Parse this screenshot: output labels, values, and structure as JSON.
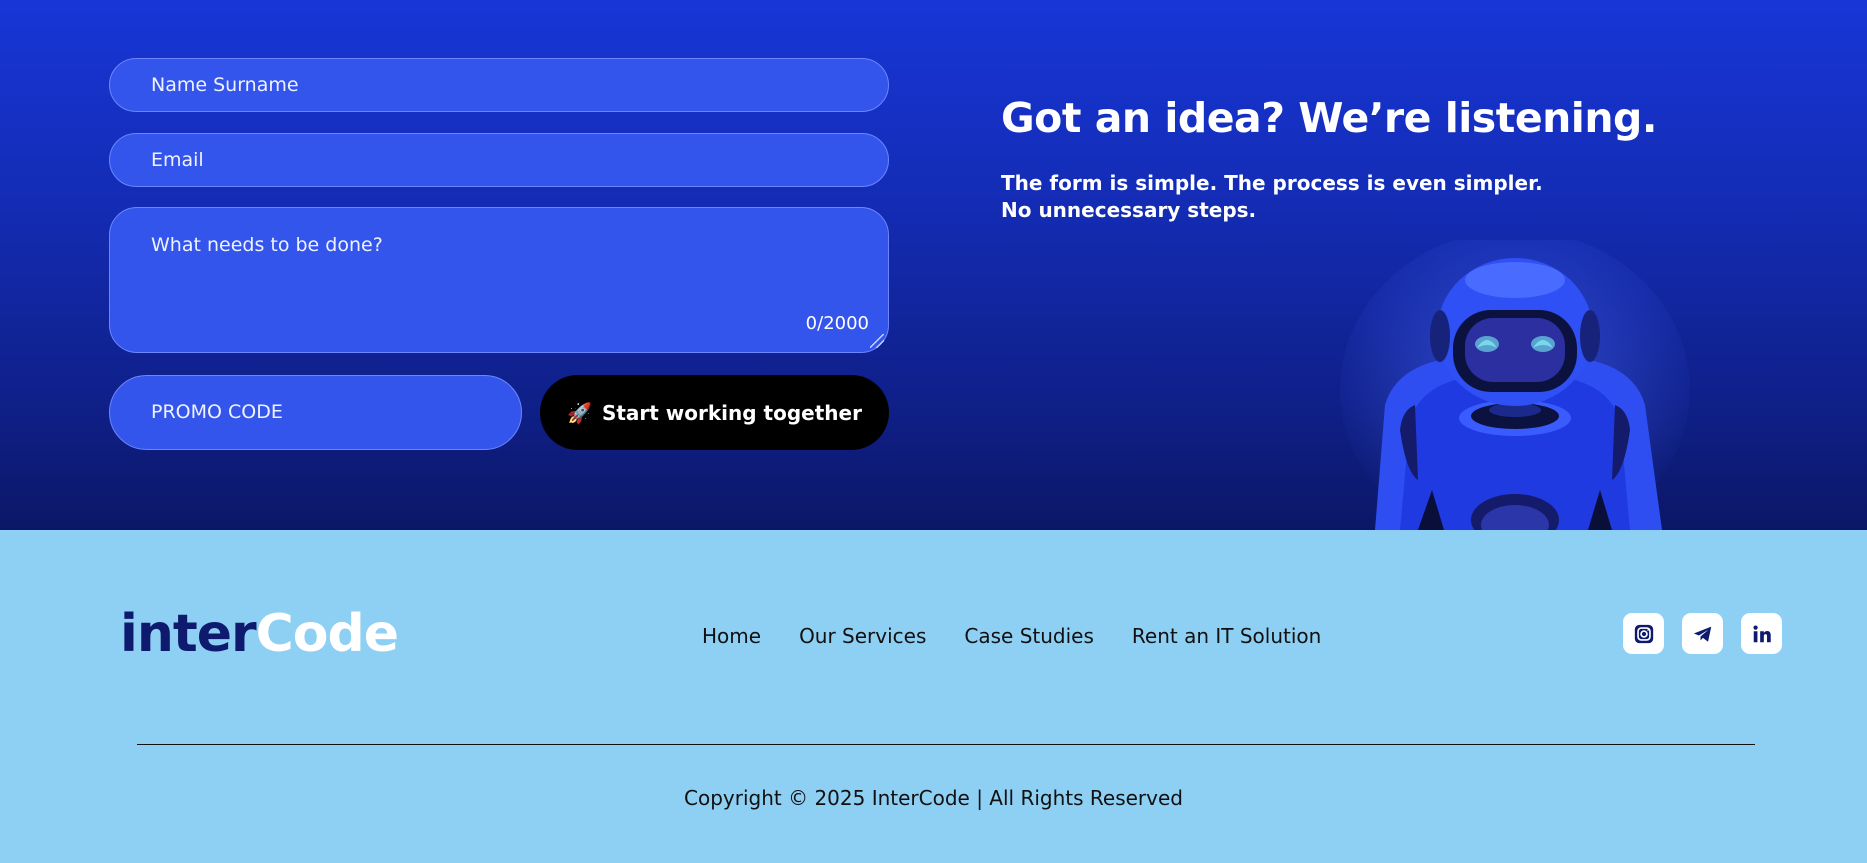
{
  "form": {
    "name_placeholder": "Name Surname",
    "email_placeholder": "Email",
    "message_placeholder": "What needs to be done?",
    "char_counter": "0/2000",
    "promo_placeholder": "PROMO CODE",
    "submit_label": "Start working together",
    "submit_icon": "🚀"
  },
  "hero": {
    "headline": "Got an idea? We’re listening.",
    "subline_1": "The form is simple. The process is even simpler.",
    "subline_2": "No unnecessary steps."
  },
  "footer": {
    "logo_part1": "inter",
    "logo_part2": "Code",
    "nav": [
      "Home",
      "Our Services",
      "Case Studies",
      "Rent an IT Solution"
    ],
    "socials": [
      "instagram-icon",
      "telegram-icon",
      "linkedin-icon"
    ],
    "copyright": "Copyright © 2025 InterCode | All Rights Reserved"
  },
  "colors": {
    "hero_top": "#1736d6",
    "hero_bottom": "#0b1766",
    "input_bg": "#3455ec",
    "footer_bg": "#8ecff4",
    "logo_dark": "#0d1a6e"
  }
}
